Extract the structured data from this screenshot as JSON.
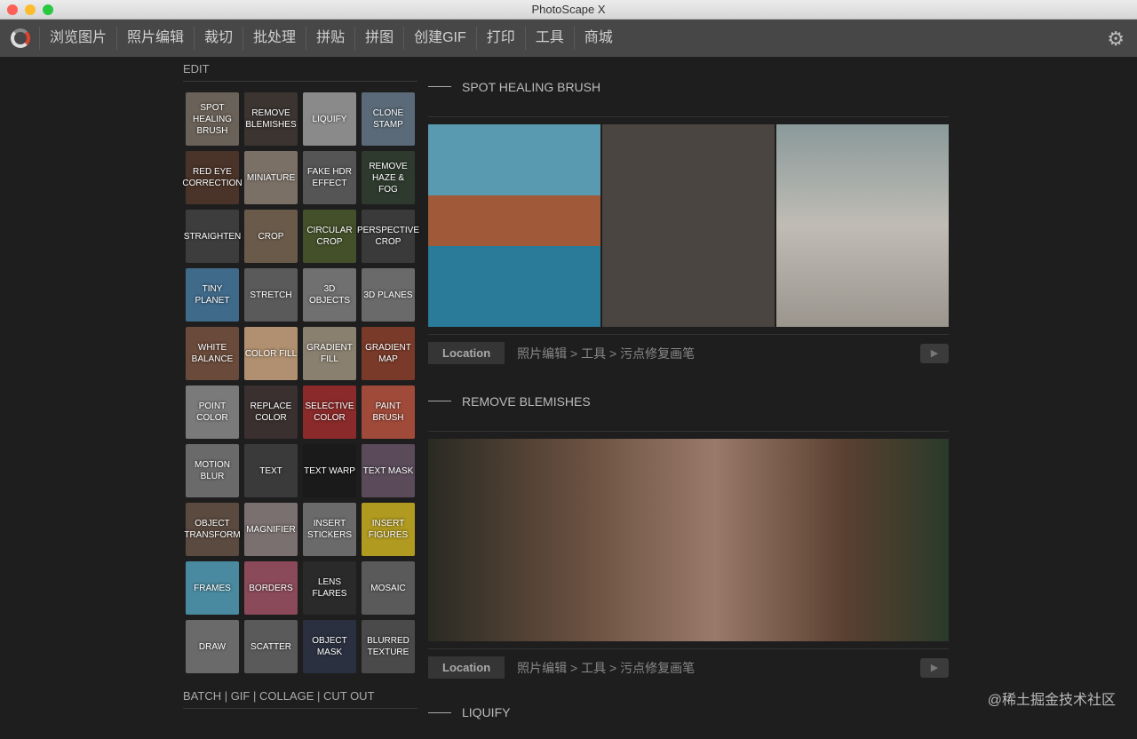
{
  "window": {
    "title": "PhotoScape X"
  },
  "menu": [
    "浏览图片",
    "照片编辑",
    "裁切",
    "批处理",
    "拼贴",
    "拼图",
    "创建GIF",
    "打印",
    "工具",
    "商城"
  ],
  "sidebar": {
    "edit_label": "EDIT",
    "bottom_label": "BATCH | GIF | COLLAGE | CUT OUT",
    "tools": [
      {
        "label": "SPOT HEALING BRUSH",
        "color": "#6a6158"
      },
      {
        "label": "REMOVE BLEMISHES",
        "color": "#3b3431"
      },
      {
        "label": "LIQUIFY",
        "color": "#8a8a8a"
      },
      {
        "label": "CLONE STAMP",
        "color": "#5a6a78"
      },
      {
        "label": "RED EYE CORRECTION",
        "color": "#4a3328"
      },
      {
        "label": "MINIATURE",
        "color": "#7a7066"
      },
      {
        "label": "FAKE HDR EFFECT",
        "color": "#555"
      },
      {
        "label": "REMOVE HAZE & FOG",
        "color": "#2e3a2e"
      },
      {
        "label": "STRAIGHTEN",
        "color": "#3d3d3d"
      },
      {
        "label": "CROP",
        "color": "#6a5a4a"
      },
      {
        "label": "CIRCULAR CROP",
        "color": "#44502a"
      },
      {
        "label": "PERSPECTIVE CROP",
        "color": "#3a3a3a"
      },
      {
        "label": "TINY PLANET",
        "color": "#3f6a8a"
      },
      {
        "label": "STRETCH",
        "color": "#5a5a5a"
      },
      {
        "label": "3D OBJECTS",
        "color": "#707070"
      },
      {
        "label": "3D PLANES",
        "color": "#6a6a6a"
      },
      {
        "label": "WHITE BALANCE",
        "color": "#6a4a3a"
      },
      {
        "label": "COLOR FILL",
        "color": "#b09070"
      },
      {
        "label": "GRADIENT FILL",
        "color": "#8a8070"
      },
      {
        "label": "GRADIENT MAP",
        "color": "#7a3a2a"
      },
      {
        "label": "POINT COLOR",
        "color": "#7a7a7a"
      },
      {
        "label": "REPLACE COLOR",
        "color": "#3a3030"
      },
      {
        "label": "SELECTIVE COLOR",
        "color": "#8a2a2a"
      },
      {
        "label": "PAINT BRUSH",
        "color": "#a04a3a"
      },
      {
        "label": "MOTION BLUR",
        "color": "#6a6a6a"
      },
      {
        "label": "TEXT",
        "color": "#3a3a3a"
      },
      {
        "label": "TEXT WARP",
        "color": "#1a1a1a"
      },
      {
        "label": "TEXT MASK",
        "color": "#5a4a5a"
      },
      {
        "label": "OBJECT TRANSFORM",
        "color": "#5a4a40"
      },
      {
        "label": "MAGNIFIER",
        "color": "#7a7070"
      },
      {
        "label": "INSERT STICKERS",
        "color": "#6a6a6a"
      },
      {
        "label": "INSERT FIGURES",
        "color": "#b09a20"
      },
      {
        "label": "FRAMES",
        "color": "#4a8aa0"
      },
      {
        "label": "BORDERS",
        "color": "#8a4a5a"
      },
      {
        "label": "LENS FLARES",
        "color": "#2a2a2a"
      },
      {
        "label": "MOSAIC",
        "color": "#5a5a5a"
      },
      {
        "label": "DRAW",
        "color": "#6a6a6a"
      },
      {
        "label": "SCATTER",
        "color": "#5a5a5a"
      },
      {
        "label": "OBJECT MASK",
        "color": "#2a3040"
      },
      {
        "label": "BLURRED TEXTURE",
        "color": "#4a4a4a"
      }
    ]
  },
  "sections": [
    {
      "title": "SPOT HEALING BRUSH",
      "location_label": "Location",
      "path": "照片编辑 > 工具 > 污点修复画笔"
    },
    {
      "title": "REMOVE BLEMISHES",
      "location_label": "Location",
      "path": "照片编辑 > 工具 > 污点修复画笔"
    },
    {
      "title": "LIQUIFY"
    }
  ],
  "credit": "@稀土掘金技术社区"
}
